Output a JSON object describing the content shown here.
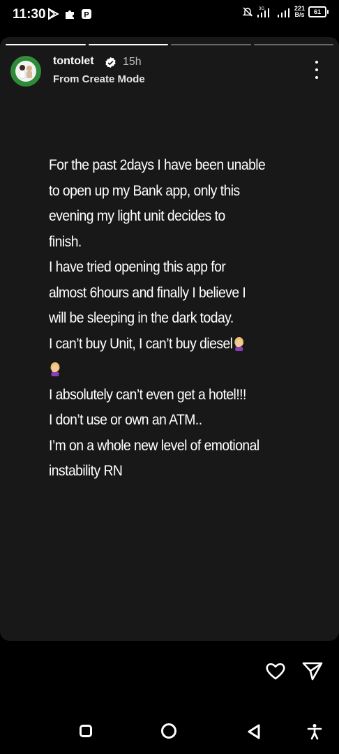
{
  "status_bar": {
    "time": "11:30",
    "network_type": "3G",
    "speed_value": "221",
    "speed_unit": "B/s",
    "battery": "61",
    "left_icons": [
      "play-store-icon",
      "puzzle-icon",
      "p-app-icon"
    ],
    "right_icons": [
      "mute-icon",
      "signal-icon",
      "signal-icon"
    ]
  },
  "story": {
    "progress_segments": [
      {
        "state": "viewed"
      },
      {
        "state": "current"
      },
      {
        "state": "pending"
      },
      {
        "state": "pending"
      }
    ],
    "username": "tontolet",
    "verified": true,
    "time_ago": "15h",
    "subtitle": "From Create Mode",
    "lines": [
      "For the past 2days I have been unable",
      "to open up my Bank app, only this",
      "evening my light unit decides to",
      "finish.",
      "I have tried opening this app for",
      "almost 6hours and finally I believe I",
      "will be sleeping in the dark today.",
      "I can’t buy Unit, I can’t buy diesel",
      "",
      "I absolutely can’t even get a hotel!!!",
      "I don’t use  or own an ATM..",
      "I’m on a whole new level of emotional",
      "instability RN"
    ]
  },
  "reply": {
    "like_icon": "heart-icon",
    "share_icon": "send-icon"
  },
  "colors": {
    "background": "#000000",
    "story_background": "#181818",
    "text": "#ffffff",
    "muted_text": "#bdbdbd",
    "verified": "#ffffff"
  }
}
